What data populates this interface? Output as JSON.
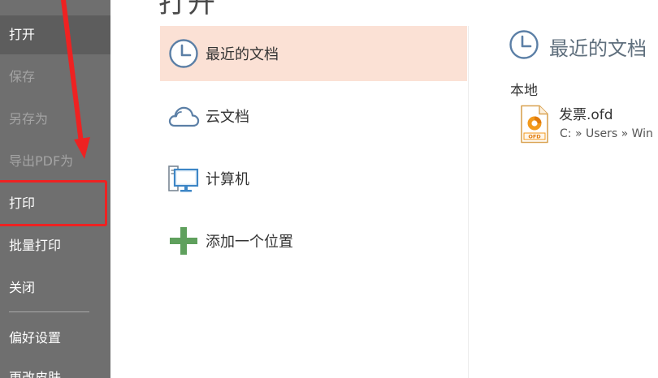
{
  "title": "打开",
  "sidebar": {
    "items": [
      {
        "label": "打开"
      },
      {
        "label": "保存"
      },
      {
        "label": "另存为"
      },
      {
        "label": "导出PDF为"
      },
      {
        "label": "打印"
      },
      {
        "label": "批量打印"
      },
      {
        "label": "关闭"
      },
      {
        "label": "偏好设置"
      },
      {
        "label": "更改皮肤"
      }
    ]
  },
  "locations": [
    {
      "label": "最近的文档",
      "icon": "clock-icon",
      "selected": true
    },
    {
      "label": "云文档",
      "icon": "cloud-icon"
    },
    {
      "label": "计算机",
      "icon": "computer-icon"
    },
    {
      "label": "添加一个位置",
      "icon": "plus-icon"
    }
  ],
  "recent": {
    "title": "最近的文档",
    "section": "本地",
    "files": [
      {
        "name": "发票.ofd",
        "path": "C: » Users » Win",
        "icon": "ofd-file-icon",
        "icon_text": "OFD"
      }
    ]
  },
  "colors": {
    "sidebar_bg": "#6f6f6f",
    "sidebar_active": "#5d5d5d",
    "selected_bg": "#fbe1d5",
    "icon_blue": "#5b7fa6",
    "plus_green": "#5fa05d",
    "annotation_red": "#ee2222",
    "ofd_orange": "#f39a1c"
  }
}
